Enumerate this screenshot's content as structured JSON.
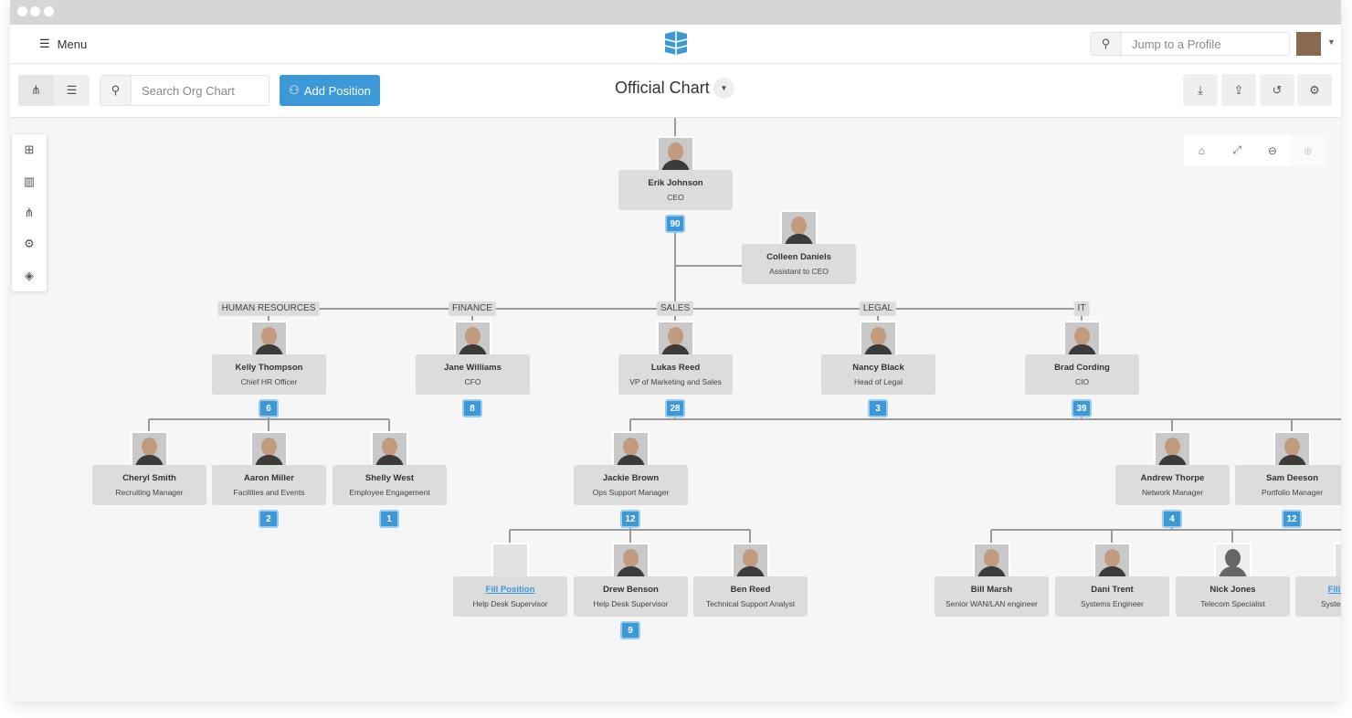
{
  "topnav": {
    "menu_label": "Menu",
    "jump_placeholder": "Jump to a Profile"
  },
  "toolbar": {
    "search_placeholder": "Search Org Chart",
    "add_position_label": "Add Position",
    "chart_title": "Official Chart"
  },
  "icons": {
    "view_tree": "org-chart-icon",
    "view_list": "list-icon",
    "tools": [
      "download-icon",
      "share-icon",
      "history-icon",
      "gear-icon"
    ],
    "zoom": [
      "home-icon",
      "expand-icon",
      "zoom-out-icon",
      "zoom-in-icon"
    ],
    "sidebar": [
      "add-box-icon",
      "building-icon",
      "hierarchy-icon",
      "gear-icon",
      "paint-bucket-icon"
    ]
  },
  "colors": {
    "accent": "#3d98d8",
    "node": "#dcdcdc",
    "canvas": "#f6f6f6"
  },
  "departments": [
    "HUMAN RESOURCES",
    "FINANCE",
    "SALES",
    "LEGAL",
    "IT"
  ],
  "nodes": [
    {
      "name": "Erik Johnson",
      "title": "CEO",
      "count": "90"
    },
    {
      "name": "Colleen Daniels",
      "title": "Assistant to CEO"
    },
    {
      "name": "Kelly Thompson",
      "title": "Chief HR Officer",
      "count": "6"
    },
    {
      "name": "Jane Williams",
      "title": "CFO",
      "count": "8"
    },
    {
      "name": "Lukas Reed",
      "title": "VP of Marketing and Sales",
      "count": "28"
    },
    {
      "name": "Nancy Black",
      "title": "Head of Legal",
      "count": "3"
    },
    {
      "name": "Brad Cording",
      "title": "CIO",
      "count": "39"
    },
    {
      "name": "Cheryl Smith",
      "title": "Recruiting Manager"
    },
    {
      "name": "Aaron Miller",
      "title": "Facilities and Events",
      "count": "2"
    },
    {
      "name": "Shelly West",
      "title": "Employee Engagement",
      "count": "1"
    },
    {
      "name": "Jackie Brown",
      "title": "Ops Support Manager",
      "count": "12"
    },
    {
      "name": "Andrew Thorpe",
      "title": "Network Manager",
      "count": "4"
    },
    {
      "name": "Sam Deeson",
      "title": "Portfolio Manager",
      "count": "12"
    },
    {
      "name": "Fill Position",
      "title": "Help Desk Supervisor",
      "vacant": true
    },
    {
      "name": "Drew Benson",
      "title": "Help Desk Supervisor",
      "count": "9"
    },
    {
      "name": "Ben Reed",
      "title": "Technical Support Analyst"
    },
    {
      "name": "Bill Marsh",
      "title": "Senior WAN/LAN engineer"
    },
    {
      "name": "Dani Trent",
      "title": "Systems Engineer"
    },
    {
      "name": "Nick Jones",
      "title": "Telecom Specialist",
      "silhouette": true
    },
    {
      "name": "Fill Position",
      "title": "Systems Engineer",
      "vacant": true
    }
  ]
}
